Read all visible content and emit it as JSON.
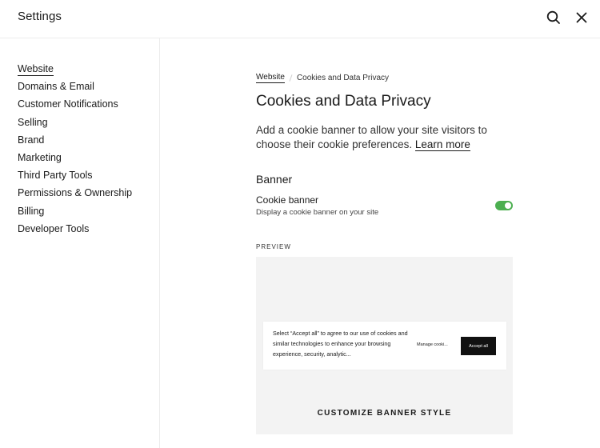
{
  "header": {
    "title": "Settings",
    "search_icon": "search-icon",
    "close_icon": "close-icon"
  },
  "sidebar": {
    "items": [
      {
        "label": "Website",
        "active": true
      },
      {
        "label": "Domains & Email"
      },
      {
        "label": "Customer Notifications"
      },
      {
        "label": "Selling"
      },
      {
        "label": "Brand"
      },
      {
        "label": "Marketing"
      },
      {
        "label": "Third Party Tools"
      },
      {
        "label": "Permissions & Ownership"
      },
      {
        "label": "Billing"
      },
      {
        "label": "Developer Tools"
      }
    ]
  },
  "main": {
    "breadcrumb": {
      "parent": "Website",
      "current": "Cookies and Data Privacy"
    },
    "title": "Cookies and Data Privacy",
    "description": "Add a cookie banner to allow your site visitors to choose their cookie preferences.",
    "learn_more": "Learn more",
    "banner_section": {
      "title": "Banner",
      "cookie_banner_label": "Cookie banner",
      "cookie_banner_sub": "Display a cookie banner on your site",
      "toggle_on": true,
      "toggle_color": "#4caf50"
    },
    "preview": {
      "label": "PREVIEW",
      "banner_text": "Select “Accept all” to agree to our use of cookies and similar technologies to enhance your browsing experience, security, analytic...",
      "manage_label": "Manage cooki...",
      "accept_label": "Accept all",
      "customize_label": "CUSTOMIZE BANNER STYLE"
    }
  }
}
